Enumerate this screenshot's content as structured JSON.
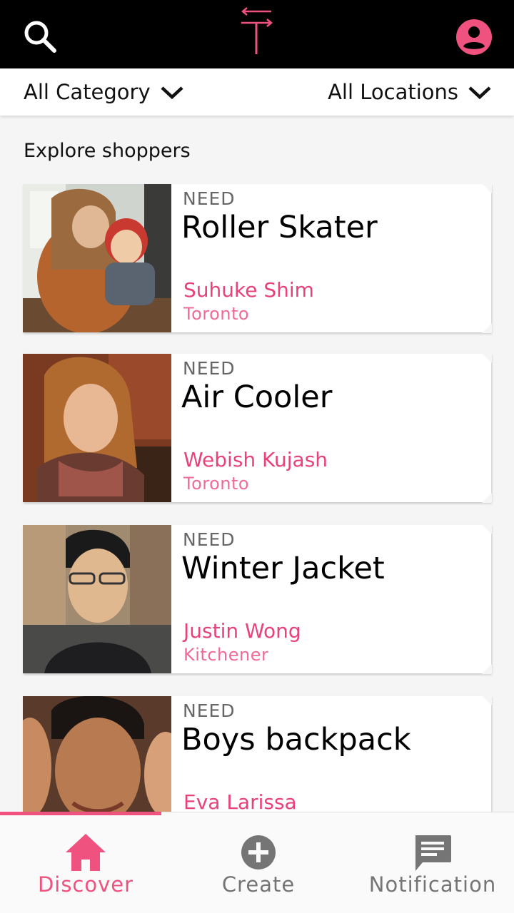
{
  "colors": {
    "accent": "#f0527f",
    "name_pink": "#e8427a",
    "header_bg": "#000000"
  },
  "header": {
    "search_icon": "search-icon",
    "logo": "t-arrow-logo",
    "account_icon": "account-circle-icon"
  },
  "filters": {
    "category": "All Category",
    "location": "All Locations"
  },
  "section_title": "Explore shoppers",
  "cards": [
    {
      "label": "NEED",
      "item": "Roller Skater",
      "name": "Suhuke Shim",
      "city": "Toronto"
    },
    {
      "label": "NEED",
      "item": "Air Cooler",
      "name": "Webish Kujash",
      "city": "Toronto"
    },
    {
      "label": "NEED",
      "item": "Winter Jacket",
      "name": "Justin Wong",
      "city": "Kitchener"
    },
    {
      "label": "NEED",
      "item": "Boys backpack",
      "name": "Eva Larissa",
      "city": ""
    }
  ],
  "bottom_nav": [
    {
      "label": "Discover",
      "icon": "home-icon",
      "active": true
    },
    {
      "label": "Create",
      "icon": "add-circle-icon",
      "active": false
    },
    {
      "label": "Notification",
      "icon": "message-icon",
      "active": false
    }
  ]
}
